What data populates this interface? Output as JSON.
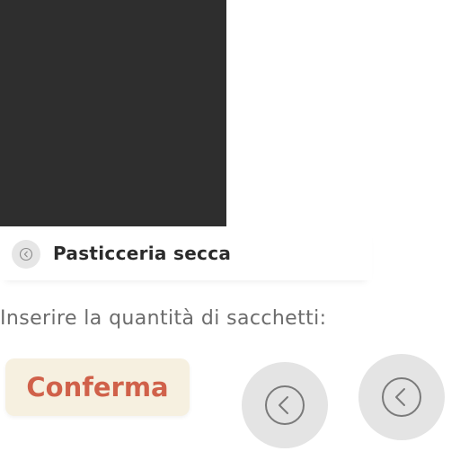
{
  "header": {
    "title": "Pasticceria secca",
    "back_icon": "chevron-left-circle-icon"
  },
  "prompt": {
    "text": "Inserire la quantità di sacchetti:"
  },
  "actions": {
    "confirm_label": "Conferma",
    "left_icon": "chevron-left-circle-icon",
    "right_icon": "chevron-left-circle-icon"
  },
  "colors": {
    "image_placeholder": "#2e2e2e",
    "confirm_bg": "#f6f0e0",
    "confirm_text": "#d0614a",
    "round_button_bg": "#e4e4e4",
    "prompt_text": "#6c6c6c",
    "title_text": "#2b2b2b"
  }
}
